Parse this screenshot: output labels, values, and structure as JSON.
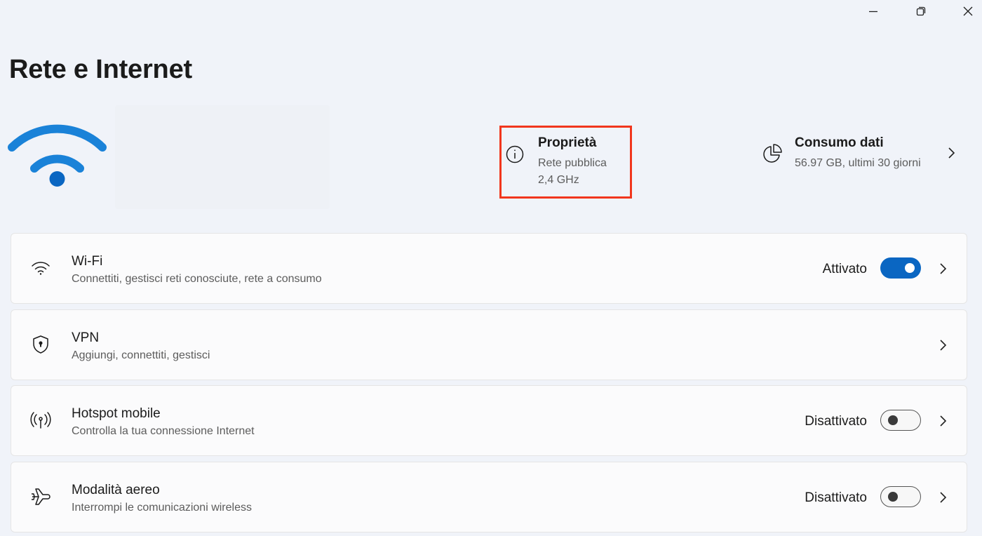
{
  "page": {
    "title": "Rete e Internet"
  },
  "window_controls": {
    "minimize_icon": "minimize-icon",
    "maximize_icon": "restore-icon",
    "close_icon": "close-icon"
  },
  "hero": {
    "icon": "wifi-signal-icon",
    "network_name": ""
  },
  "properties": {
    "icon": "info-icon",
    "title": "Proprietà",
    "network_type": "Rete pubblica",
    "band": "2,4 GHz",
    "highlight_color": "#f1361d"
  },
  "data_usage": {
    "icon": "pie-chart-icon",
    "title": "Consumo dati",
    "summary": "56.97 GB, ultimi 30 giorni"
  },
  "accent_color": "#0a66c2",
  "settings": [
    {
      "icon": "wifi-icon",
      "title": "Wi-Fi",
      "subtitle": "Connettiti, gestisci reti conosciute, rete a consumo",
      "status": "Attivato",
      "toggle_on": true
    },
    {
      "icon": "shield-lock-icon",
      "title": "VPN",
      "subtitle": "Aggiungi, connettiti, gestisci"
    },
    {
      "icon": "hotspot-icon",
      "title": "Hotspot mobile",
      "subtitle": "Controlla la tua connessione Internet",
      "status": "Disattivato",
      "toggle_on": false
    },
    {
      "icon": "airplane-icon",
      "title": "Modalità aereo",
      "subtitle": "Interrompi le comunicazioni wireless",
      "status": "Disattivato",
      "toggle_on": false
    }
  ]
}
